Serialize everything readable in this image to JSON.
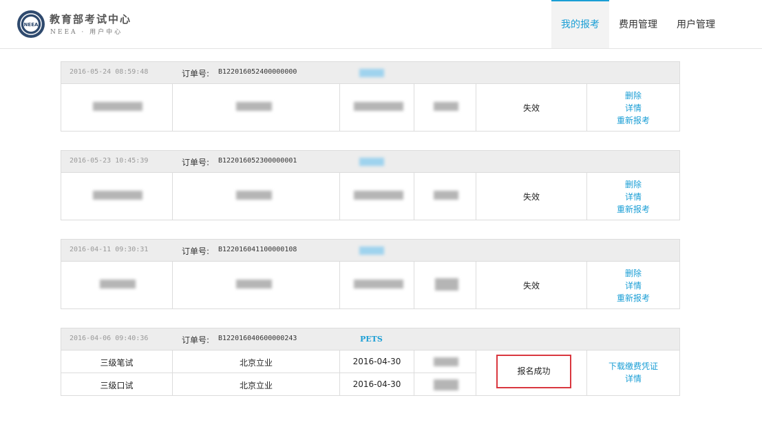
{
  "header": {
    "brand_cn": "教育部考试中心",
    "brand_en": "NEEA · 用户中心",
    "logo_text": "NEEA",
    "nav": [
      {
        "label": "我的报考",
        "active": true
      },
      {
        "label": "费用管理",
        "active": false
      },
      {
        "label": "用户管理",
        "active": false
      }
    ]
  },
  "orders": [
    {
      "time": "2016-05-24 08:59:48",
      "order_no_label": "订单号:",
      "order_no": "B122016052400000000",
      "status": "失效",
      "actions": [
        "删除",
        "详情",
        "重新报考"
      ]
    },
    {
      "time": "2016-05-23 10:45:39",
      "order_no_label": "订单号:",
      "order_no": "B122016052300000001",
      "status": "失效",
      "actions": [
        "删除",
        "详情",
        "重新报考"
      ]
    },
    {
      "time": "2016-04-11 09:30:31",
      "order_no_label": "订单号:",
      "order_no": "B122016041100000108",
      "status": "失效",
      "actions": [
        "删除",
        "详情",
        "重新报考"
      ]
    },
    {
      "time": "2016-04-06 09:40:36",
      "order_no_label": "订单号:",
      "order_no": "B122016040600000243",
      "exam": "PETS",
      "rows": [
        {
          "subject": "三级笔试",
          "location": "北京立业",
          "date": "2016-04-30"
        },
        {
          "subject": "三级口试",
          "location": "北京立业",
          "date": "2016-04-30"
        }
      ],
      "status": "报名成功",
      "actions": [
        "下载缴费凭证",
        "详情"
      ]
    }
  ],
  "colors": {
    "accent": "#1a9ed5",
    "highlight": "#d9363e",
    "header_bg": "#ededed"
  }
}
